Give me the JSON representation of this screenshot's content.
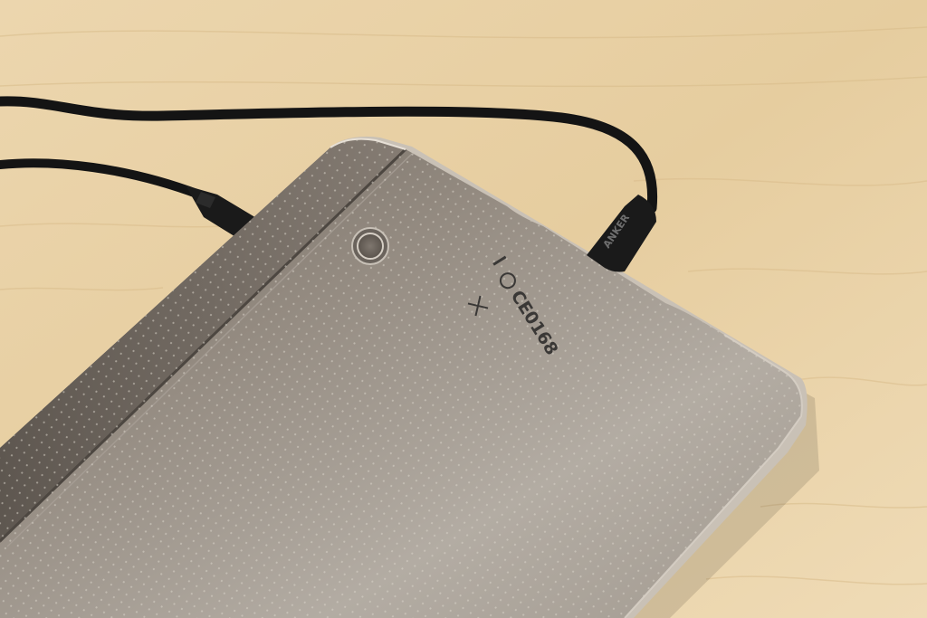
{
  "photo": {
    "regulatory_mark": "CE0168",
    "cable_brand": "ANKER"
  },
  "colors": {
    "wood": "#e9d2a8",
    "tablet_body": "#8f877d",
    "cable": "#141414"
  }
}
